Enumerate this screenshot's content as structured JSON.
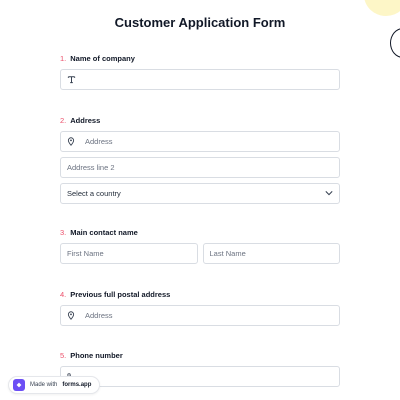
{
  "form": {
    "title": "Customer Application Form",
    "questions": [
      {
        "number": "1.",
        "label": "Name of company"
      },
      {
        "number": "2.",
        "label": "Address"
      },
      {
        "number": "3.",
        "label": "Main contact name"
      },
      {
        "number": "4.",
        "label": "Previous full postal address"
      },
      {
        "number": "5.",
        "label": "Phone number"
      }
    ],
    "address": {
      "line1_placeholder": "Address",
      "line2_placeholder": "Address line 2",
      "country_select": "Select a country"
    },
    "contact": {
      "first_placeholder": "First Name",
      "last_placeholder": "Last Name"
    },
    "previous_address": {
      "placeholder": "Address"
    }
  },
  "footer": {
    "badge_prefix": "Made with",
    "badge_brand": "forms.app"
  },
  "colors": {
    "accent_number": "#ec4f6a",
    "brand": "#6c4ff5",
    "border": "#d9dde3"
  },
  "icons": {
    "company_field": "text-icon",
    "address_field": "location-pin-icon",
    "select": "chevron-down-icon",
    "phone_field": "phone-icon",
    "badge": "forms-app-logo-icon"
  }
}
